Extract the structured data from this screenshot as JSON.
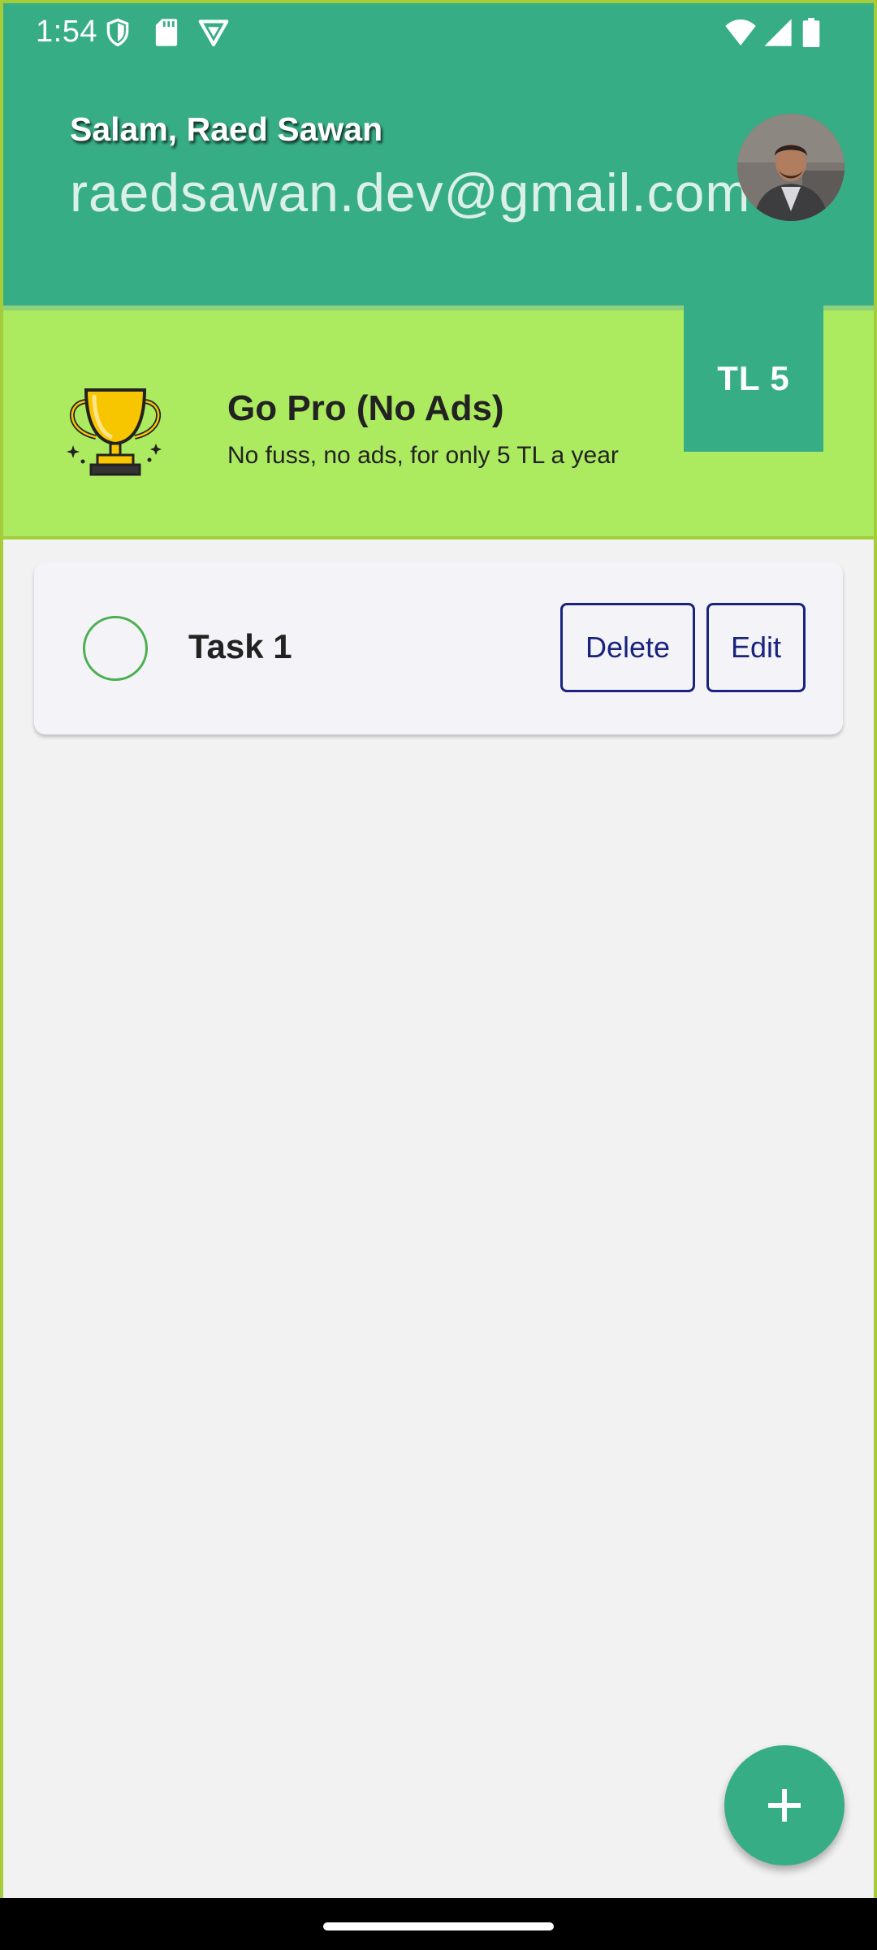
{
  "status_bar": {
    "time": "1:54",
    "left_icons": [
      "shield-icon",
      "sd-card-icon",
      "vpn-icon"
    ],
    "right_icons": [
      "wifi-icon",
      "signal-icon",
      "battery-icon"
    ]
  },
  "header": {
    "greeting": "Salam, Raed Sawan",
    "email": "raedsawan.dev@gmail.com",
    "background_color": "#37ad86"
  },
  "promo": {
    "title": "Go Pro (No Ads)",
    "subtitle": "No fuss, no ads, for only 5 TL a year",
    "price": "TL 5",
    "icon": "trophy-icon",
    "background_color": "#acea60"
  },
  "tasks": [
    {
      "title": "Task 1",
      "completed": false,
      "delete_label": "Delete",
      "edit_label": "Edit"
    }
  ],
  "fab": {
    "icon": "plus-icon"
  },
  "colors": {
    "accent": "#37ad86",
    "border": "#a5cc3a",
    "button_outline": "#1a237e",
    "checkbox": "#4caf50"
  }
}
